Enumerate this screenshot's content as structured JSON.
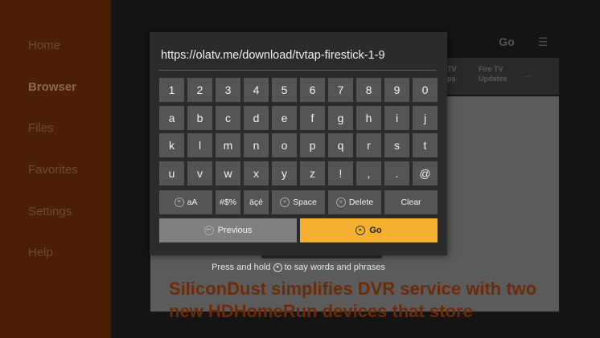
{
  "sidebar": {
    "items": [
      {
        "label": "Home"
      },
      {
        "label": "Browser"
      },
      {
        "label": "Files"
      },
      {
        "label": "Favorites"
      },
      {
        "label": "Settings"
      },
      {
        "label": "Help"
      }
    ],
    "active_index": 1
  },
  "browser": {
    "go_label": "Go",
    "menu_icon": "hamburger-menu-icon",
    "tabs": [
      {
        "label": "TV\nps"
      },
      {
        "label": "Fire TV\nUpdates"
      }
    ],
    "more_icon": "ellipsis-icon",
    "headline": "SiliconDust simplifies DVR service with two new HDHomeRun devices that store"
  },
  "keyboard": {
    "url": "https://olatv.me/download/tvtap-firestick-1-9",
    "rows": [
      [
        "1",
        "2",
        "3",
        "4",
        "5",
        "6",
        "7",
        "8",
        "9",
        "0"
      ],
      [
        "a",
        "b",
        "c",
        "d",
        "e",
        "f",
        "g",
        "h",
        "i",
        "j"
      ],
      [
        "k",
        "l",
        "m",
        "n",
        "o",
        "p",
        "q",
        "r",
        "s",
        "t"
      ],
      [
        "u",
        "v",
        "w",
        "x",
        "y",
        "z",
        "!",
        ",",
        ".",
        "@"
      ]
    ],
    "function_keys": {
      "case": "aA",
      "symbols": "#$%",
      "accents": "äçé",
      "space": "Space",
      "delete": "Delete",
      "clear": "Clear"
    },
    "previous": "Previous",
    "go": "Go",
    "hint": "Press and hold",
    "hint_tail": "to say words and phrases"
  },
  "colors": {
    "sidebar": "#4a1f04",
    "key": "#555555",
    "go_button": "#f3b12f",
    "previous_button": "#808080"
  }
}
